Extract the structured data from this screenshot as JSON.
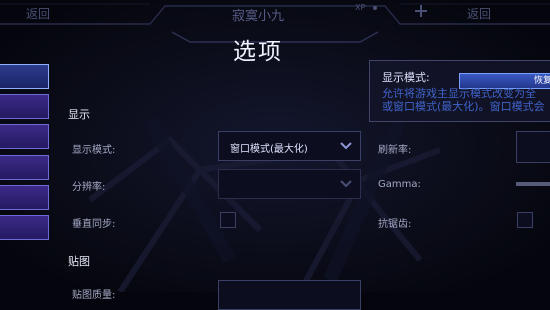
{
  "topbar": {
    "left_label": "返回",
    "center_label": "寂寞小九",
    "xp_label": "XP",
    "right_label": "返回"
  },
  "page_title": "选项",
  "sections": {
    "display": "显示",
    "textures": "贴图"
  },
  "settings": {
    "display_mode_label": "显示模式:",
    "display_mode_value": "窗口模式(最大化)",
    "resolution_label": "分辨率:",
    "resolution_value": "",
    "vsync_label": "垂直同步:",
    "refresh_label": "刷新率:",
    "gamma_label": "Gamma:",
    "antialias_label": "抗锯齿:",
    "texture_quality_label": "贴图质量:"
  },
  "tooltip": {
    "title": "显示模式:",
    "line1": "允许将游戏主显示模式改变为全",
    "line2": "或窗口模式(最大化)。窗口模式会",
    "button_label": "恢复"
  },
  "icons": [
    "chevron-down-icon",
    "plus-icon"
  ]
}
